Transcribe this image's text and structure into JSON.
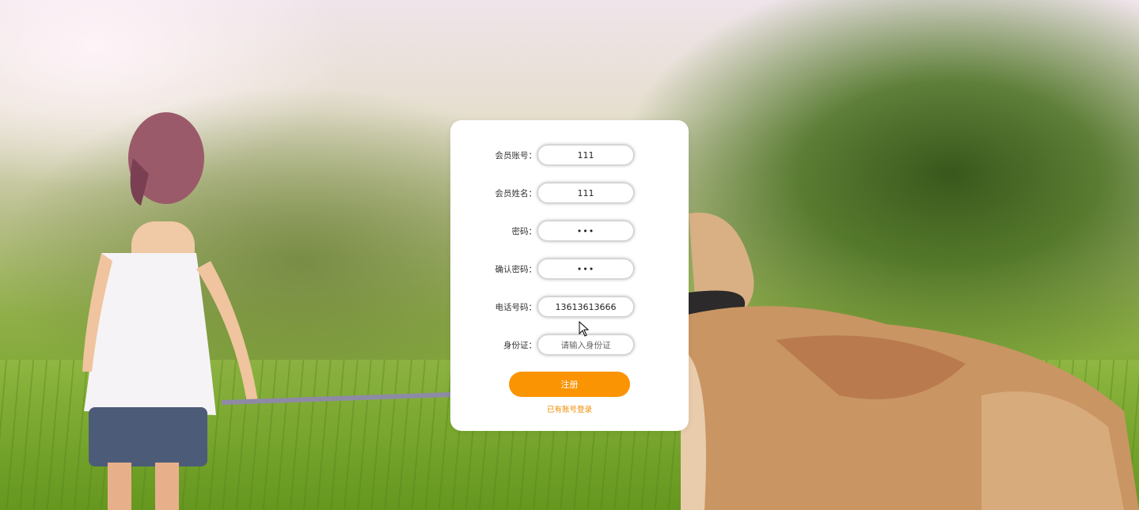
{
  "form": {
    "fields": [
      {
        "label": "会员账号：",
        "value": "111",
        "type": "text",
        "placeholder": ""
      },
      {
        "label": "会员姓名：",
        "value": "111",
        "type": "text",
        "placeholder": ""
      },
      {
        "label": "密码：",
        "value": "•••",
        "type": "password",
        "placeholder": ""
      },
      {
        "label": "确认密码：",
        "value": "•••",
        "type": "password",
        "placeholder": ""
      },
      {
        "label": "电话号码：",
        "value": "13613613666",
        "type": "text",
        "placeholder": ""
      },
      {
        "label": "身份证：",
        "value": "",
        "type": "text",
        "placeholder": "请输入身份证"
      }
    ],
    "submit_label": "注册",
    "login_link": "已有账号登录"
  },
  "colors": {
    "accent": "#fb9402",
    "link": "#f08c00",
    "card": "#ffffff"
  },
  "icons": {
    "cursor": "mouse-pointer-icon"
  }
}
